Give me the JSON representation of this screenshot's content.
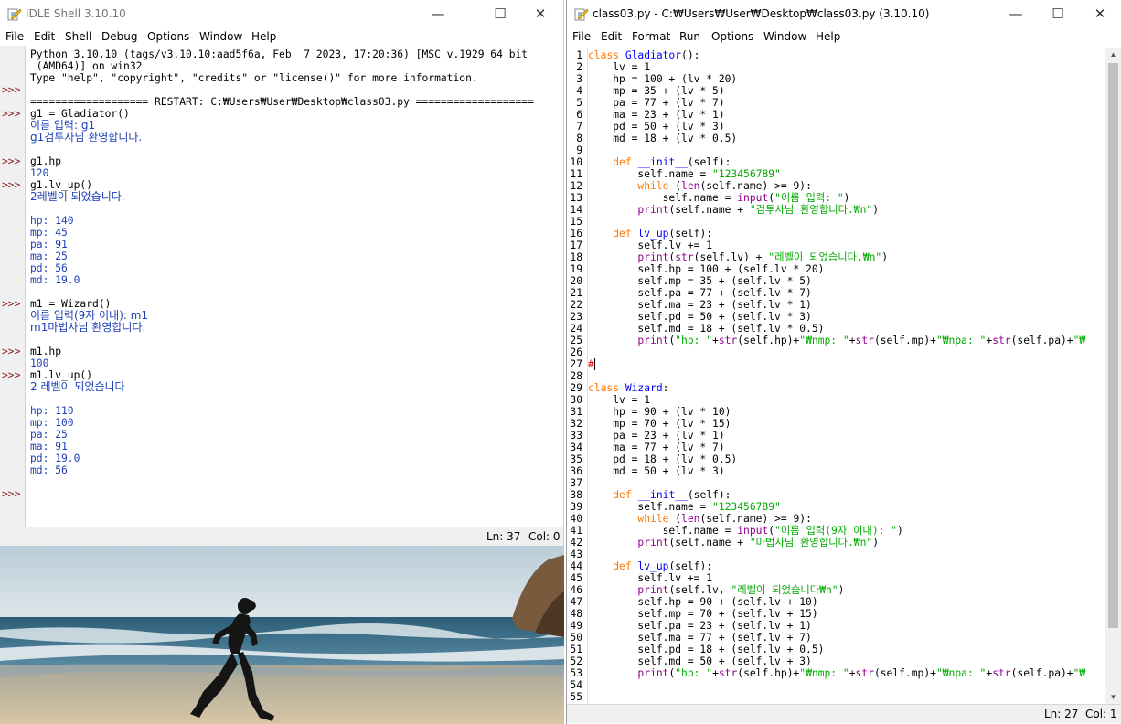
{
  "shell": {
    "title": "IDLE Shell 3.10.10",
    "menus": [
      "File",
      "Edit",
      "Shell",
      "Debug",
      "Options",
      "Window",
      "Help"
    ],
    "prompt": ">>>",
    "banner": [
      "Python 3.10.10 (tags/v3.10.10:aad5f6a, Feb  7 2023, 17:20:36) [MSC v.1929 64 bit",
      " (AMD64)] on win32",
      "Type \"help\", \"copyright\", \"credits\" or \"license()\" for more information."
    ],
    "restart": "=================== RESTART: C:₩Users₩User₩Desktop₩class03.py ===================",
    "session": [
      {
        "kind": "inp",
        "text": "g1 = Gladiator()"
      },
      {
        "kind": "out",
        "text": "이름 입력: g1"
      },
      {
        "kind": "out",
        "text": "g1검투사님 환영합니다."
      },
      {
        "kind": "blank",
        "text": ""
      },
      {
        "kind": "inp",
        "text": "g1.hp"
      },
      {
        "kind": "out",
        "text": "120"
      },
      {
        "kind": "inp",
        "text": "g1.lv_up()"
      },
      {
        "kind": "out",
        "text": "2레벨이 되었습니다."
      },
      {
        "kind": "blank",
        "text": ""
      },
      {
        "kind": "out",
        "text": "hp: 140"
      },
      {
        "kind": "out",
        "text": "mp: 45"
      },
      {
        "kind": "out",
        "text": "pa: 91"
      },
      {
        "kind": "out",
        "text": "ma: 25"
      },
      {
        "kind": "out",
        "text": "pd: 56"
      },
      {
        "kind": "out",
        "text": "md: 19.0"
      },
      {
        "kind": "blank",
        "text": ""
      },
      {
        "kind": "inp",
        "text": "m1 = Wizard()"
      },
      {
        "kind": "out",
        "text": "이름 입력(9자 이내): m1"
      },
      {
        "kind": "out",
        "text": "m1마법사님 환영합니다."
      },
      {
        "kind": "blank",
        "text": ""
      },
      {
        "kind": "inp",
        "text": "m1.hp"
      },
      {
        "kind": "out",
        "text": "100"
      },
      {
        "kind": "inp",
        "text": "m1.lv_up()"
      },
      {
        "kind": "out",
        "text": "2 레벨이 되었습니다"
      },
      {
        "kind": "blank",
        "text": ""
      },
      {
        "kind": "out",
        "text": "hp: 110"
      },
      {
        "kind": "out",
        "text": "mp: 100"
      },
      {
        "kind": "out",
        "text": "pa: 25"
      },
      {
        "kind": "out",
        "text": "ma: 91"
      },
      {
        "kind": "out",
        "text": "pd: 19.0"
      },
      {
        "kind": "out",
        "text": "md: 56"
      },
      {
        "kind": "blank",
        "text": ""
      },
      {
        "kind": "prompt",
        "text": ""
      }
    ],
    "status": {
      "ln": "Ln: 37",
      "col": "Col: 0"
    }
  },
  "editor": {
    "title": "class03.py - C:₩Users₩User₩Desktop₩class03.py (3.10.10)",
    "menus": [
      "File",
      "Edit",
      "Format",
      "Run",
      "Options",
      "Window",
      "Help"
    ],
    "status": {
      "ln": "Ln: 27",
      "col": "Col: 1"
    },
    "lines": [
      [
        [
          "kw",
          "class "
        ],
        [
          "def",
          "Gladiator"
        ],
        [
          "",
          "():"
        ]
      ],
      [
        [
          "",
          "    lv = 1"
        ]
      ],
      [
        [
          "",
          "    hp = 100 + (lv * 20)"
        ]
      ],
      [
        [
          "",
          "    mp = 35 + (lv * 5)"
        ]
      ],
      [
        [
          "",
          "    pa = 77 + (lv * 7)"
        ]
      ],
      [
        [
          "",
          "    ma = 23 + (lv * 1)"
        ]
      ],
      [
        [
          "",
          "    pd = 50 + (lv * 3)"
        ]
      ],
      [
        [
          "",
          "    md = 18 + (lv * 0.5)"
        ]
      ],
      [],
      [
        [
          "",
          "    "
        ],
        [
          "kw",
          "def "
        ],
        [
          "def",
          "__init__"
        ],
        [
          "",
          "(self):"
        ]
      ],
      [
        [
          "",
          "        self.name = "
        ],
        [
          "str",
          "\"123456789\""
        ]
      ],
      [
        [
          "",
          "        "
        ],
        [
          "kw",
          "while "
        ],
        [
          "",
          "("
        ],
        [
          "bi",
          "len"
        ],
        [
          "",
          "(self.name) >= 9):"
        ]
      ],
      [
        [
          "",
          "            self.name = "
        ],
        [
          "bi",
          "input"
        ],
        [
          "",
          "("
        ],
        [
          "str",
          "\"이름 입력: \""
        ],
        [
          "",
          ")"
        ]
      ],
      [
        [
          "",
          "        "
        ],
        [
          "bi",
          "print"
        ],
        [
          "",
          "(self.name + "
        ],
        [
          "str",
          "\"검투사님 환영합니다.₩n\""
        ],
        [
          "",
          ")"
        ]
      ],
      [],
      [
        [
          "",
          "    "
        ],
        [
          "kw",
          "def "
        ],
        [
          "def",
          "lv_up"
        ],
        [
          "",
          "(self):"
        ]
      ],
      [
        [
          "",
          "        self.lv += 1"
        ]
      ],
      [
        [
          "",
          "        "
        ],
        [
          "bi",
          "print"
        ],
        [
          "",
          "("
        ],
        [
          "bi",
          "str"
        ],
        [
          "",
          "(self.lv) + "
        ],
        [
          "str",
          "\"레벨이 되었습니다.₩n\""
        ],
        [
          "",
          ")"
        ]
      ],
      [
        [
          "",
          "        self.hp = 100 + (self.lv * 20)"
        ]
      ],
      [
        [
          "",
          "        self.mp = 35 + (self.lv * 5)"
        ]
      ],
      [
        [
          "",
          "        self.pa = 77 + (self.lv * 7)"
        ]
      ],
      [
        [
          "",
          "        self.ma = 23 + (self.lv * 1)"
        ]
      ],
      [
        [
          "",
          "        self.pd = 50 + (self.lv * 3)"
        ]
      ],
      [
        [
          "",
          "        self.md = 18 + (self.lv * 0.5)"
        ]
      ],
      [
        [
          "",
          "        "
        ],
        [
          "bi",
          "print"
        ],
        [
          "",
          "("
        ],
        [
          "str",
          "\"hp: \""
        ],
        [
          "",
          "+"
        ],
        [
          "bi",
          "str"
        ],
        [
          "",
          "(self.hp)+"
        ],
        [
          "str",
          "\"₩nmp: \""
        ],
        [
          "",
          "+"
        ],
        [
          "bi",
          "str"
        ],
        [
          "",
          "(self.mp)+"
        ],
        [
          "str",
          "\"₩npa: \""
        ],
        [
          "",
          "+"
        ],
        [
          "bi",
          "str"
        ],
        [
          "",
          "(self.pa)+"
        ],
        [
          "str",
          "\"₩"
        ]
      ],
      [],
      [
        [
          "com",
          "#"
        ],
        [
          "cursor",
          ""
        ]
      ],
      [],
      [
        [
          "kw",
          "class "
        ],
        [
          "def",
          "Wizard"
        ],
        [
          "",
          ":"
        ]
      ],
      [
        [
          "",
          "    lv = 1"
        ]
      ],
      [
        [
          "",
          "    hp = 90 + (lv * 10)"
        ]
      ],
      [
        [
          "",
          "    mp = 70 + (lv * 15)"
        ]
      ],
      [
        [
          "",
          "    pa = 23 + (lv * 1)"
        ]
      ],
      [
        [
          "",
          "    ma = 77 + (lv * 7)"
        ]
      ],
      [
        [
          "",
          "    pd = 18 + (lv * 0.5)"
        ]
      ],
      [
        [
          "",
          "    md = 50 + (lv * 3)"
        ]
      ],
      [],
      [
        [
          "",
          "    "
        ],
        [
          "kw",
          "def "
        ],
        [
          "def",
          "__init__"
        ],
        [
          "",
          "(self):"
        ]
      ],
      [
        [
          "",
          "        self.name = "
        ],
        [
          "str",
          "\"123456789\""
        ]
      ],
      [
        [
          "",
          "        "
        ],
        [
          "kw",
          "while "
        ],
        [
          "",
          "("
        ],
        [
          "bi",
          "len"
        ],
        [
          "",
          "(self.name) >= 9):"
        ]
      ],
      [
        [
          "",
          "            self.name = "
        ],
        [
          "bi",
          "input"
        ],
        [
          "",
          "("
        ],
        [
          "str",
          "\"이름 입력(9자 이내): \""
        ],
        [
          "",
          ")"
        ]
      ],
      [
        [
          "",
          "        "
        ],
        [
          "bi",
          "print"
        ],
        [
          "",
          "(self.name + "
        ],
        [
          "str",
          "\"마법사님 환영합니다.₩n\""
        ],
        [
          "",
          ")"
        ]
      ],
      [],
      [
        [
          "",
          "    "
        ],
        [
          "kw",
          "def "
        ],
        [
          "def",
          "lv_up"
        ],
        [
          "",
          "(self):"
        ]
      ],
      [
        [
          "",
          "        self.lv += 1"
        ]
      ],
      [
        [
          "",
          "        "
        ],
        [
          "bi",
          "print"
        ],
        [
          "",
          "(self.lv, "
        ],
        [
          "str",
          "\"레벨이 되었습니다₩n\""
        ],
        [
          "",
          ")"
        ]
      ],
      [
        [
          "",
          "        self.hp = 90 + (self.lv + 10)"
        ]
      ],
      [
        [
          "",
          "        self.mp = 70 + (self.lv + 15)"
        ]
      ],
      [
        [
          "",
          "        self.pa = 23 + (self.lv + 1)"
        ]
      ],
      [
        [
          "",
          "        self.ma = 77 + (self.lv + 7)"
        ]
      ],
      [
        [
          "",
          "        self.pd = 18 + (self.lv + 0.5)"
        ]
      ],
      [
        [
          "",
          "        self.md = 50 + (self.lv + 3)"
        ]
      ],
      [
        [
          "",
          "        "
        ],
        [
          "bi",
          "print"
        ],
        [
          "",
          "("
        ],
        [
          "str",
          "\"hp: \""
        ],
        [
          "",
          "+"
        ],
        [
          "bi",
          "str"
        ],
        [
          "",
          "(self.hp)+"
        ],
        [
          "str",
          "\"₩nmp: \""
        ],
        [
          "",
          "+"
        ],
        [
          "bi",
          "str"
        ],
        [
          "",
          "(self.mp)+"
        ],
        [
          "str",
          "\"₩npa: \""
        ],
        [
          "",
          "+"
        ],
        [
          "bi",
          "str"
        ],
        [
          "",
          "(self.pa)+"
        ],
        [
          "str",
          "\"₩"
        ]
      ],
      [],
      []
    ]
  }
}
